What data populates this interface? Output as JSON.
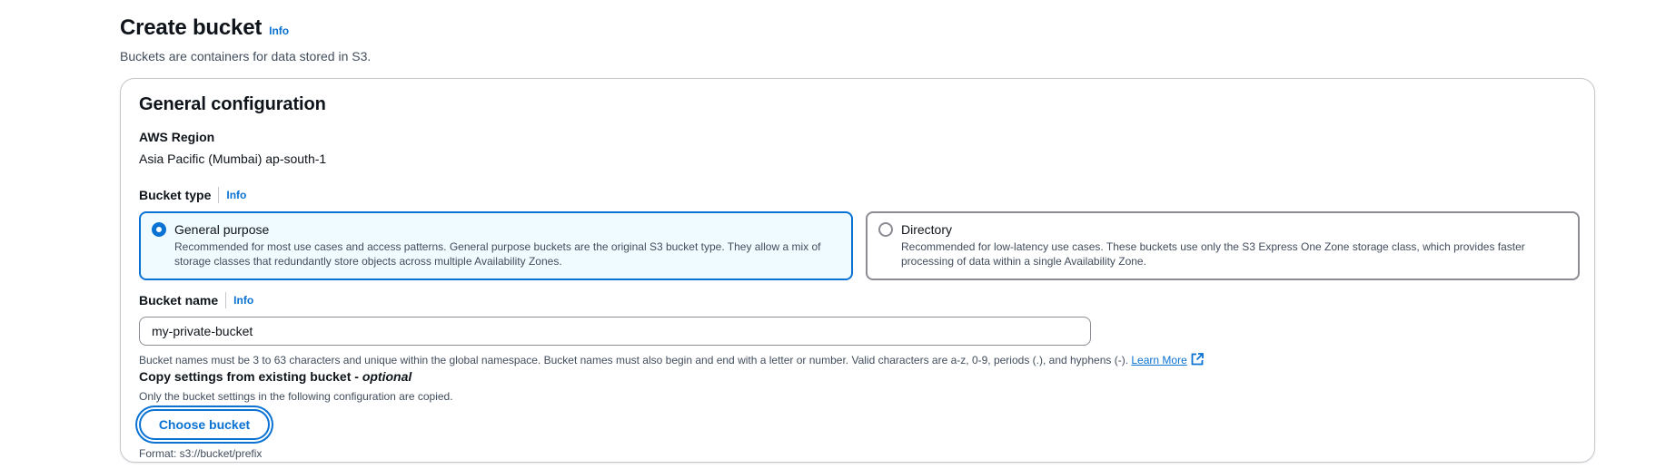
{
  "header": {
    "title": "Create bucket",
    "info_label": "Info",
    "description": "Buckets are containers for data stored in S3."
  },
  "general_config": {
    "title": "General configuration",
    "region": {
      "label": "AWS Region",
      "value": "Asia Pacific (Mumbai) ap-south-1"
    },
    "bucket_type": {
      "label": "Bucket type",
      "info_label": "Info",
      "selected": "General purpose",
      "options": [
        {
          "title": "General purpose",
          "description": "Recommended for most use cases and access patterns. General purpose buckets are the original S3 bucket type. They allow a mix of storage classes that redundantly store objects across multiple Availability Zones.",
          "checked": true
        },
        {
          "title": "Directory",
          "description": "Recommended for low-latency use cases. These buckets use only the S3 Express One Zone storage class, which provides faster processing of data within a single Availability Zone.",
          "checked": false
        }
      ]
    },
    "bucket_name": {
      "label": "Bucket name",
      "info_label": "Info",
      "value": "my-private-bucket",
      "constraint": "Bucket names must be 3 to 63 characters and unique within the global namespace. Bucket names must also begin and end with a letter or number. Valid characters are a-z, 0-9, periods (.), and hyphens (-).",
      "learn_more": "Learn More"
    },
    "copy_settings": {
      "label": "Copy settings from existing bucket - ",
      "optional": "optional",
      "description": "Only the bucket settings in the following configuration are copied.",
      "button_label": "Choose bucket",
      "format_hint": "Format: s3://bucket/prefix"
    }
  },
  "colors": {
    "accent": "#0972d3",
    "selected_tile_bg": "#f0fbff",
    "text_secondary": "#414d5c",
    "border": "#8c8c94"
  }
}
